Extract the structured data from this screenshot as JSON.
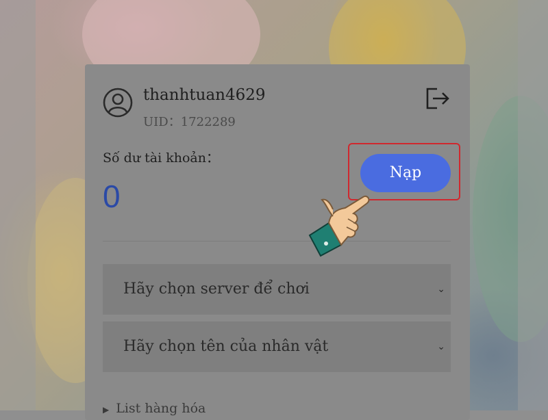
{
  "account": {
    "username": "thanhtuan4629",
    "uid_text": "UID：1722289"
  },
  "balance": {
    "label": "Số dư tài khoản：",
    "value": "0"
  },
  "topup_button": {
    "label": "Nạp"
  },
  "selects": {
    "server_placeholder": "Hãy chọn server để chơi",
    "character_placeholder": "Hãy chọn tên của nhân vật"
  },
  "list": {
    "header": "List hàng hóa"
  },
  "icons": {
    "avatar": "user-circle-icon",
    "logout": "logout-icon",
    "chevron": "chevron-down-icon",
    "pointer": "pointing-hand-icon"
  },
  "colors": {
    "accent": "#4a6ce0",
    "balance": "#2b4aa6",
    "highlight": "#d0282e"
  }
}
